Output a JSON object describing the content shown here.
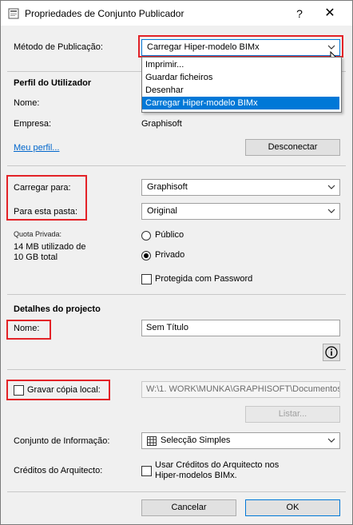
{
  "window": {
    "title": "Propriedades de Conjunto Publicador",
    "help": "?",
    "close": "✕"
  },
  "publish_method": {
    "label": "Método de Publicação:",
    "value": "Carregar Hiper-modelo BIMx",
    "options": [
      "Imprimir...",
      "Guardar ficheiros",
      "Desenhar",
      "Carregar Hiper-modelo BIMx"
    ],
    "selected_index": 3
  },
  "profile": {
    "heading": "Perfil do Utilizador",
    "name_label": "Nome:",
    "name_value": "",
    "company_label": "Empresa:",
    "company_value": "Graphisoft",
    "my_profile_link": "Meu perfil...",
    "disconnect_button": "Desconectar"
  },
  "upload": {
    "upload_to_label": "Carregar para:",
    "upload_to_value": "Graphisoft",
    "folder_label": "Para esta pasta:",
    "folder_value": "Original",
    "quota_label": "Quota Privada:",
    "quota_value": "14 MB utilizado de 10 GB total",
    "quota_line1": "14 MB utilizado de",
    "quota_line2": "10 GB total",
    "public_label": "Público",
    "private_label": "Privado",
    "visibility": "Privado",
    "password_label": "Protegida com Password",
    "password_checked": false
  },
  "project": {
    "heading": "Detalhes do projecto",
    "name_label": "Nome:",
    "name_value": "Sem Título",
    "info_icon": "info-icon"
  },
  "local_copy": {
    "label": "Gravar cópia local:",
    "checked": false,
    "path_value": "W:\\1. WORK\\MUNKA\\GRAPHISOFT\\Documentos",
    "list_button": "Listar..."
  },
  "info_set": {
    "label": "Conjunto de Informação:",
    "value": "Selecção Simples"
  },
  "architect_credits": {
    "label": "Créditos do Arquitecto:",
    "checkbox_line1": "Usar Créditos do Arquitecto nos",
    "checkbox_line2": "Hiper-modelos BIMx.",
    "checked": false
  },
  "footer": {
    "cancel": "Cancelar",
    "ok": "OK"
  },
  "colors": {
    "highlight": "#e32227",
    "selection": "#0078d7",
    "link": "#0066cc"
  }
}
